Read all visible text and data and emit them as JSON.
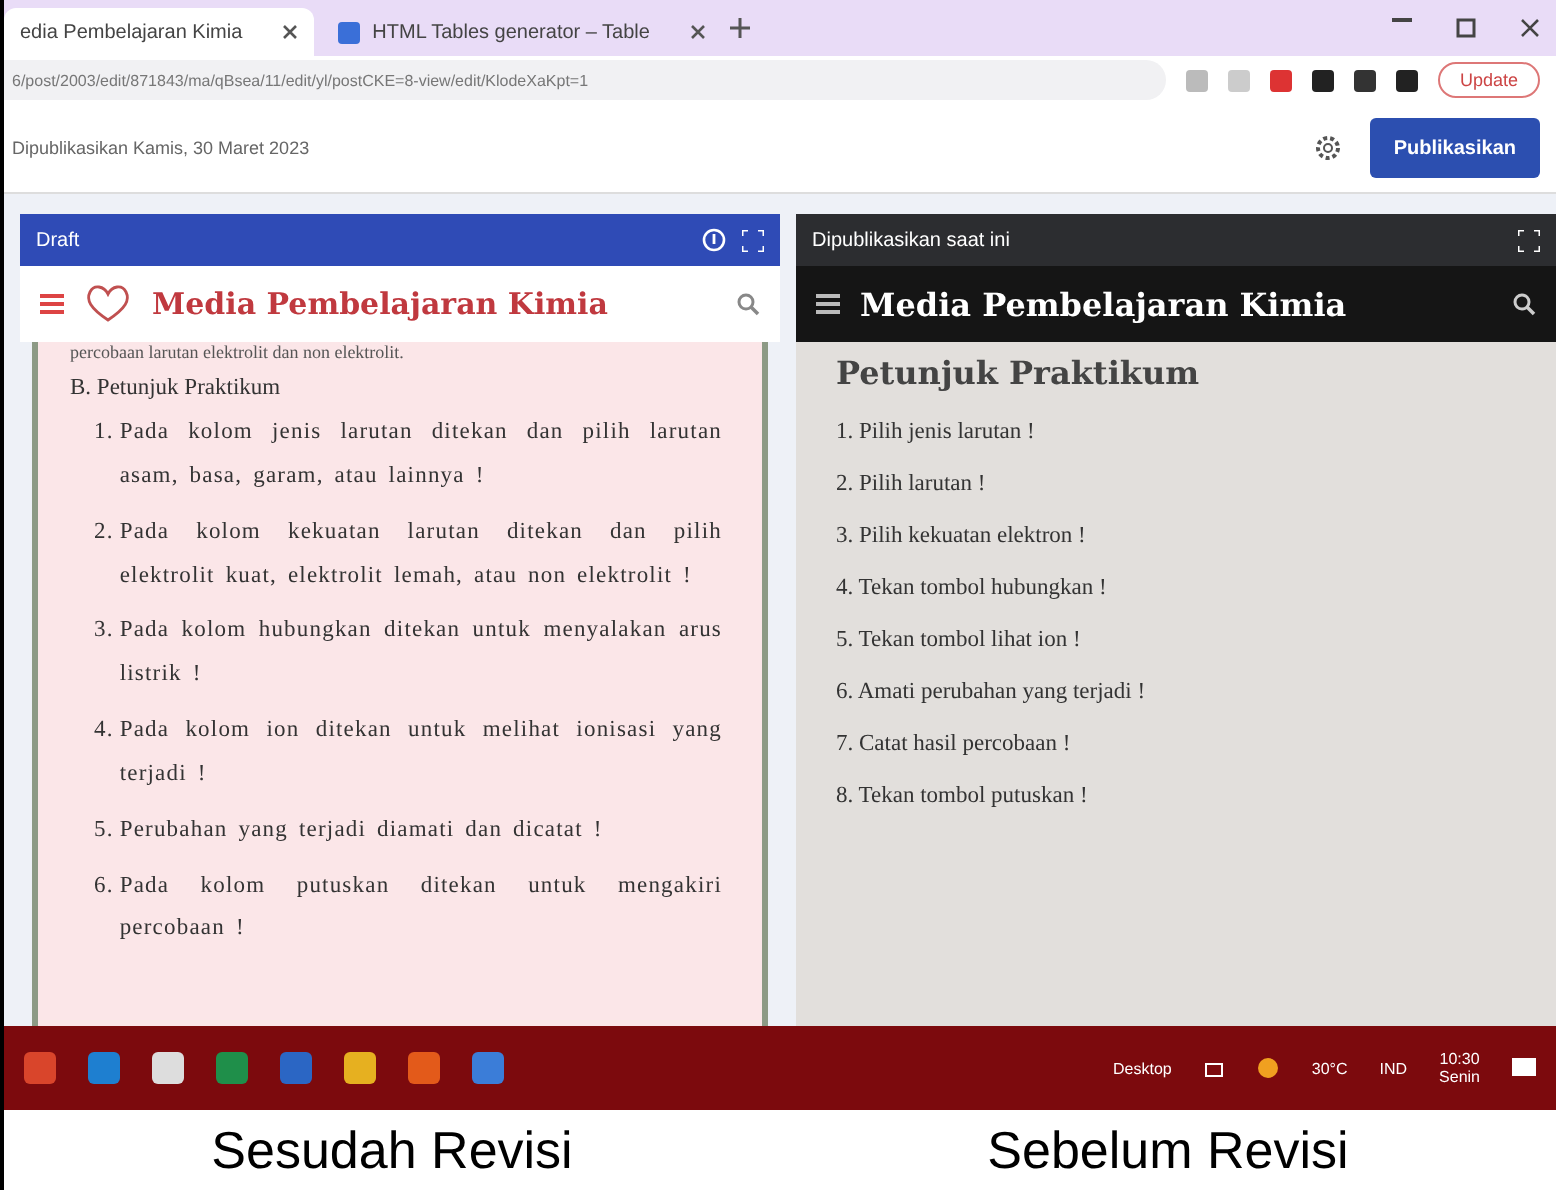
{
  "browser": {
    "tabs": [
      {
        "title": "edia Pembelajaran Kimia",
        "selected": true
      },
      {
        "title": "HTML Tables generator – Table",
        "selected": false
      }
    ],
    "address": "6/post/2003/edit/871843/ma/qBsea/11/edit/yl/postCKE=8-view/edit/KlodeXaKpt=1",
    "update_label": "Update"
  },
  "editor": {
    "status": "Dipublikasikan Kamis, 30 Maret 2023",
    "publish_label": "Publikasikan"
  },
  "draft": {
    "title": "Draft",
    "blog_title": "Media Pembelajaran Kimia",
    "cut_line": "percobaan larutan elektrolit dan non elektrolit.",
    "section": "B. Petunjuk Praktikum",
    "steps": [
      {
        "number": "1.",
        "text": "Pada kolom jenis larutan ditekan dan pilih larutan asam, basa, garam, atau lainnya !"
      },
      {
        "number": "2.",
        "text": "Pada kolom kekuatan larutan ditekan dan pilih elektrolit kuat, elektrolit lemah, atau non elektrolit !"
      },
      {
        "number": "3.",
        "text": "Pada kolom hubungkan ditekan untuk menyalakan arus listrik !"
      },
      {
        "number": "4.",
        "text": "Pada kolom ion ditekan untuk melihat ionisasi yang terjadi !"
      },
      {
        "number": "5.",
        "text": "Perubahan yang terjadi diamati dan dicatat !"
      },
      {
        "number": "6.",
        "text": "Pada kolom putuskan ditekan untuk mengakiri percobaan !"
      }
    ]
  },
  "published": {
    "title": "Dipublikasikan saat ini",
    "blog_title": "Media Pembelajaran Kimia",
    "heading": "Petunjuk Praktikum",
    "steps": [
      "1. Pilih jenis larutan !",
      "2. Pilih larutan !",
      "3. Pilih kekuatan elektron !",
      "4. Tekan tombol hubungkan !",
      "5. Tekan tombol lihat ion !",
      "6. Amati perubahan yang terjadi !",
      "7. Catat hasil percobaan !",
      "8. Tekan tombol putuskan !"
    ]
  },
  "taskbar": {
    "desktop_label": "Desktop",
    "weather": "30°C",
    "language": "IND",
    "time": "10:30",
    "day": "Senin"
  },
  "captions": [
    "Sesudah Revisi",
    "Sebelum Revisi"
  ]
}
